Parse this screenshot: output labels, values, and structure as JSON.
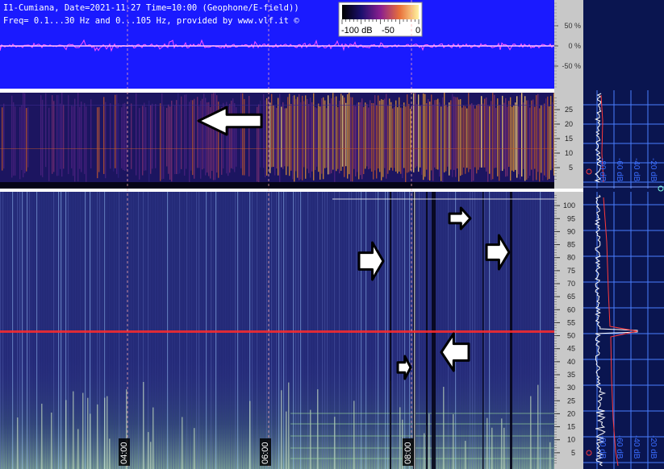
{
  "header": {
    "line1": "I1-Cumiana, Date=2021-11-27 Time=10:00 (Geophone/E-field))",
    "line2": "Freq= 0.1...30 Hz and 0...105 Hz, provided by www.vlf.it ©"
  },
  "colorbar": {
    "labels": [
      "-100 dB",
      "-50",
      "0"
    ]
  },
  "colors": {
    "waveform_bg": "#1a1aff",
    "spectrogram_bg": "#22207a",
    "low_bg": "#13104a",
    "signal_line": "#ff2a2a",
    "profile_panel_bg": "#0a1550",
    "grid_blue": "#4a7fff"
  },
  "chart_data": [
    {
      "type": "line",
      "panel": "waveform",
      "ylabel_ticks": [
        "50 %",
        "0 %",
        "-50 %"
      ],
      "y_ticks": [
        50,
        0,
        -50
      ],
      "ylim": [
        -80,
        80
      ]
    },
    {
      "type": "heatmap",
      "panel": "spectrogram-0-30Hz",
      "y_ticks": [
        5,
        10,
        15,
        20,
        25
      ],
      "ylim": [
        0,
        30
      ]
    },
    {
      "type": "heatmap",
      "panel": "spectrogram-0-105Hz",
      "x_ticks": [
        "04:00",
        "06:00",
        "08:00"
      ],
      "y_ticks": [
        5,
        10,
        15,
        20,
        25,
        30,
        35,
        40,
        45,
        50,
        55,
        60,
        65,
        70,
        75,
        80,
        85,
        90,
        95,
        100
      ],
      "ylim": [
        0,
        105
      ],
      "notable_line_hz": 50
    },
    {
      "type": "line",
      "panel": "profile-upper",
      "x_ticks": [
        "-100 dB",
        "-80 dB",
        "-60 dB",
        "-40 dB",
        "-20 dB"
      ]
    },
    {
      "type": "line",
      "panel": "profile-lower",
      "x_ticks": [
        "-100 dB",
        "-80 dB",
        "-60 dB",
        "-40 dB",
        "-20 dB"
      ]
    }
  ],
  "arrows": [
    {
      "direction": "left"
    },
    {
      "direction": "right"
    },
    {
      "direction": "right"
    },
    {
      "direction": "right"
    },
    {
      "direction": "right"
    },
    {
      "direction": "left"
    }
  ]
}
